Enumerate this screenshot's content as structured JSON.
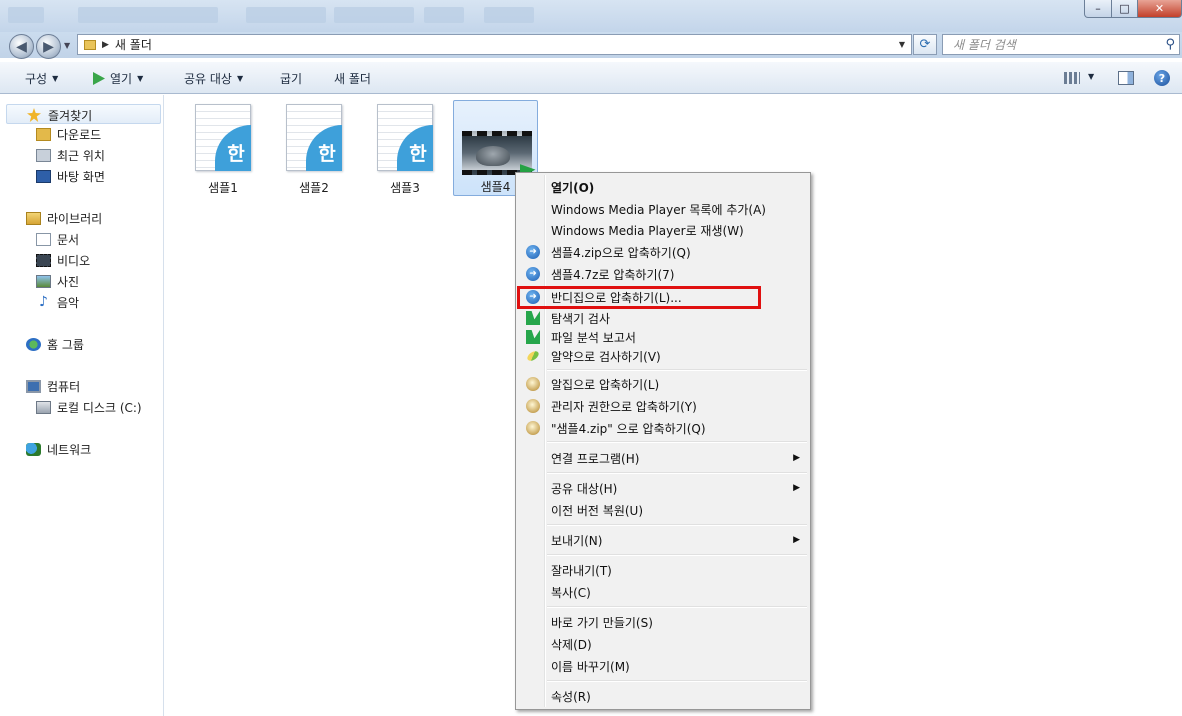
{
  "window": {
    "minimize_label": "–",
    "maximize_label": "□",
    "close_label": "✕"
  },
  "address": {
    "path_folder": "새 폴더",
    "search_placeholder": "새 폴더 검색",
    "refresh_icon": "refresh-icon"
  },
  "toolbar": {
    "organize": "구성",
    "open": "열기",
    "share": "공유 대상",
    "burn": "굽기",
    "new_folder": "새 폴더"
  },
  "sidebar": {
    "favorites": "즐겨찾기",
    "fav_items": [
      "다운로드",
      "최근 위치",
      "바탕 화면"
    ],
    "libraries": "라이브러리",
    "lib_items": [
      "문서",
      "비디오",
      "사진",
      "음악"
    ],
    "homegroup": "홈 그룹",
    "computer": "컴퓨터",
    "computer_items": [
      "로컬 디스크 (C:)"
    ],
    "network": "네트워크"
  },
  "files": [
    {
      "name": "샘플1",
      "type": "hwp",
      "glyph": "한"
    },
    {
      "name": "샘플2",
      "type": "hwp",
      "glyph": "한"
    },
    {
      "name": "샘플3",
      "type": "hwp",
      "glyph": "한"
    },
    {
      "name": "샘플4",
      "type": "video",
      "selected": true
    }
  ],
  "context_menu": {
    "items": [
      {
        "label": "열기(O)",
        "bold": true
      },
      {
        "label": "Windows Media Player 목록에 추가(A)"
      },
      {
        "label": "Windows Media Player로 재생(W)"
      },
      {
        "label": "샘플4.zip으로 압축하기(Q)",
        "icon": "bandizip-icon"
      },
      {
        "label": "샘플4.7z로 압축하기(7)",
        "icon": "bandizip-icon"
      },
      {
        "label": "반디집으로 압축하기(L)...",
        "icon": "bandizip-icon",
        "highlighted": true
      },
      {
        "label": "탐색기 검사",
        "icon": "v3-icon"
      },
      {
        "label": "파일 분석 보고서",
        "icon": "v3-report-icon"
      },
      {
        "label": "알약으로 검사하기(V)",
        "icon": "alyac-icon"
      },
      {
        "label": "알집으로 압축하기(L)",
        "icon": "alzip-icon"
      },
      {
        "label": "관리자 권한으로 압축하기(Y)",
        "icon": "alzip-admin-icon"
      },
      {
        "label": "\"샘플4.zip\" 으로 압축하기(Q)",
        "icon": "alzip-icon"
      },
      {
        "label": "연결 프로그램(H)",
        "submenu": true
      },
      {
        "label": "공유 대상(H)",
        "submenu": true
      },
      {
        "label": "이전 버전 복원(U)"
      },
      {
        "label": "보내기(N)",
        "submenu": true
      },
      {
        "label": "잘라내기(T)"
      },
      {
        "label": "복사(C)"
      },
      {
        "label": "바로 가기 만들기(S)"
      },
      {
        "label": "삭제(D)"
      },
      {
        "label": "이름 바꾸기(M)"
      },
      {
        "label": "속성(R)"
      }
    ]
  },
  "colors": {
    "highlight_border": "#e01010",
    "selection": "#cde3fa",
    "hwp_blue": "#3ea0da"
  }
}
